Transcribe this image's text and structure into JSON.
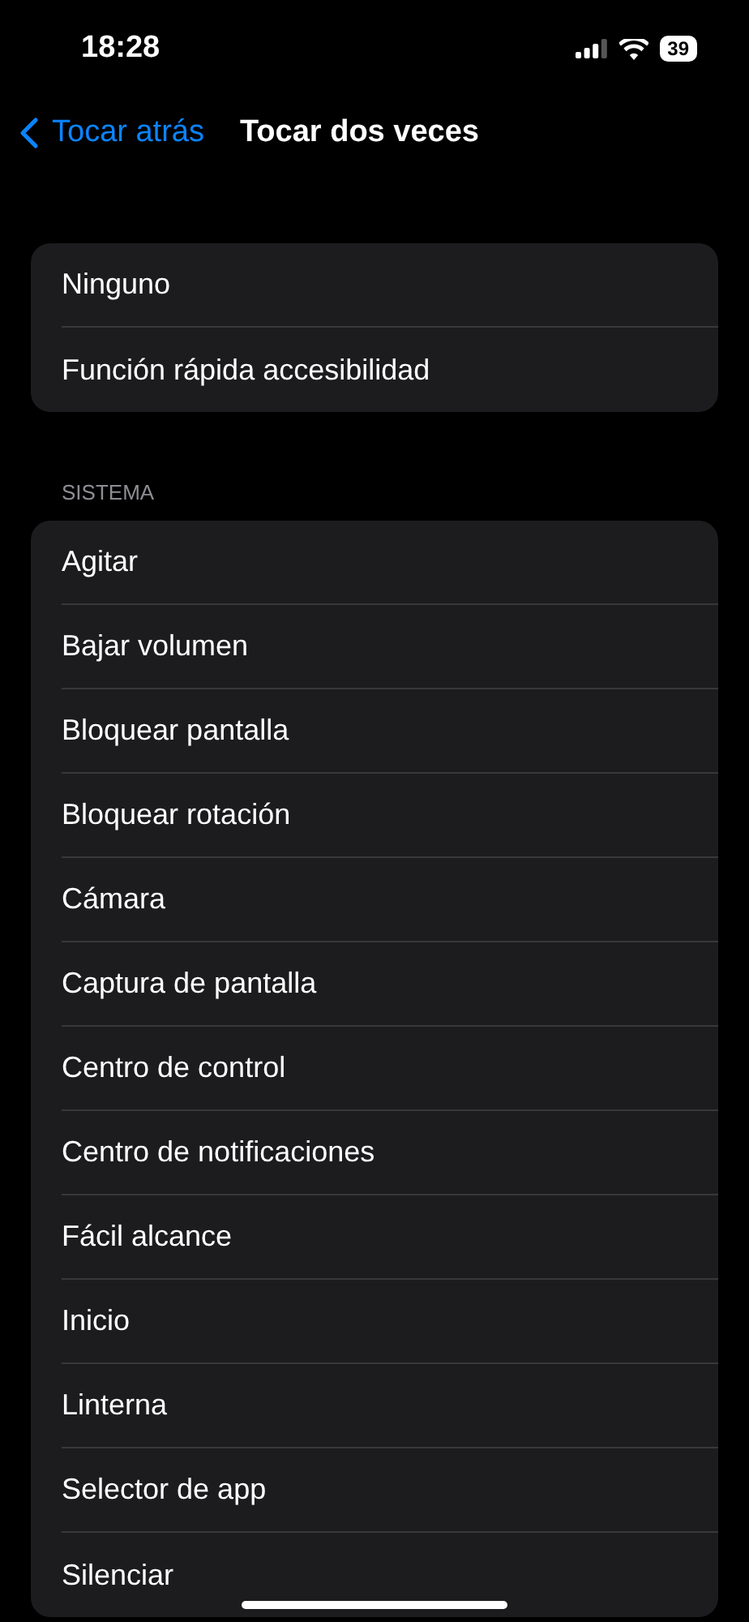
{
  "status_bar": {
    "time": "18:28",
    "battery": "39"
  },
  "nav": {
    "back": "Tocar atrás",
    "title": "Tocar dos veces"
  },
  "groups": [
    {
      "items": [
        {
          "label": "Ninguno"
        },
        {
          "label": "Función rápida accesibilidad"
        }
      ]
    },
    {
      "header": "SISTEMA",
      "items": [
        {
          "label": "Agitar"
        },
        {
          "label": "Bajar volumen"
        },
        {
          "label": "Bloquear pantalla"
        },
        {
          "label": "Bloquear rotación"
        },
        {
          "label": "Cámara"
        },
        {
          "label": "Captura de pantalla"
        },
        {
          "label": "Centro de control"
        },
        {
          "label": "Centro de notificaciones"
        },
        {
          "label": "Fácil alcance"
        },
        {
          "label": "Inicio"
        },
        {
          "label": "Linterna"
        },
        {
          "label": "Selector de app"
        },
        {
          "label": "Silenciar"
        }
      ]
    }
  ]
}
